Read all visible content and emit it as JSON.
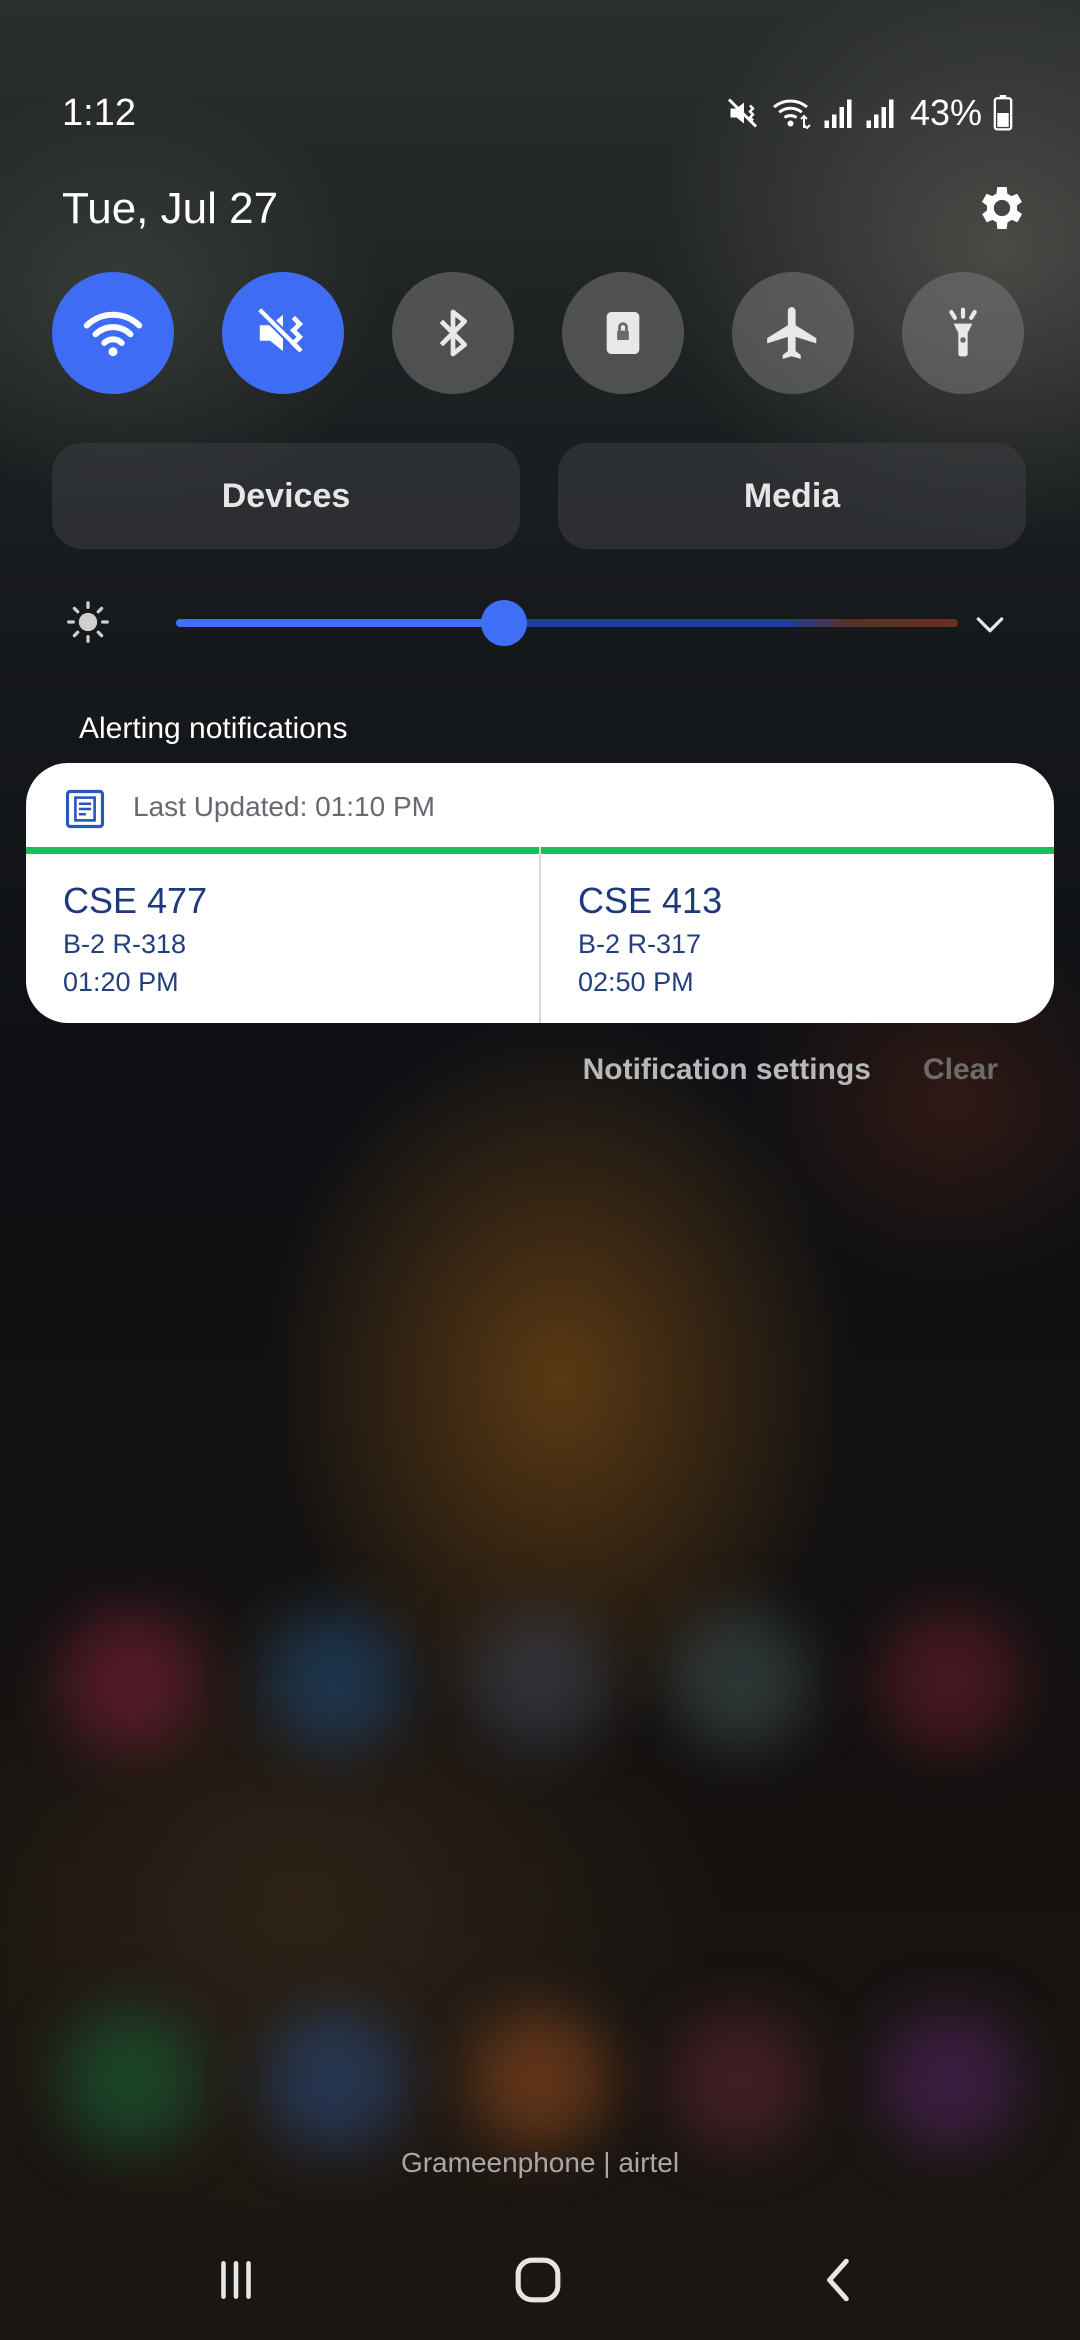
{
  "status_bar": {
    "time": "1:12",
    "battery_percent": "43%",
    "icons": [
      "mute-vibrate-icon",
      "wifi-icon",
      "signal-icon",
      "signal-icon",
      "battery-icon"
    ]
  },
  "panel": {
    "date": "Tue, Jul 27",
    "settings_icon": "gear-icon"
  },
  "quick_settings": [
    {
      "icon": "wifi-icon",
      "state": "on"
    },
    {
      "icon": "mute-icon",
      "state": "on"
    },
    {
      "icon": "bluetooth-icon",
      "state": "off"
    },
    {
      "icon": "rotation-lock-icon",
      "state": "off"
    },
    {
      "icon": "airplane-icon",
      "state": "off"
    },
    {
      "icon": "flashlight-icon",
      "state": "off"
    }
  ],
  "buttons": {
    "devices": "Devices",
    "media": "Media"
  },
  "brightness": {
    "level": 0.42
  },
  "notifications": {
    "section_label": "Alerting notifications",
    "card": {
      "last_updated": "Last Updated: 01:10 PM",
      "courses": [
        {
          "title": "CSE 477",
          "room": "B-2 R-318",
          "time": "01:20 PM"
        },
        {
          "title": "CSE 413",
          "room": "B-2 R-317",
          "time": "02:50 PM"
        }
      ]
    },
    "settings_label": "Notification settings",
    "clear_label": "Clear"
  },
  "carrier": "Grameenphone | airtel",
  "colors": {
    "accent": "#3e6cf5",
    "progress_green": "#14c05a",
    "course_text": "#1e3a7a"
  }
}
